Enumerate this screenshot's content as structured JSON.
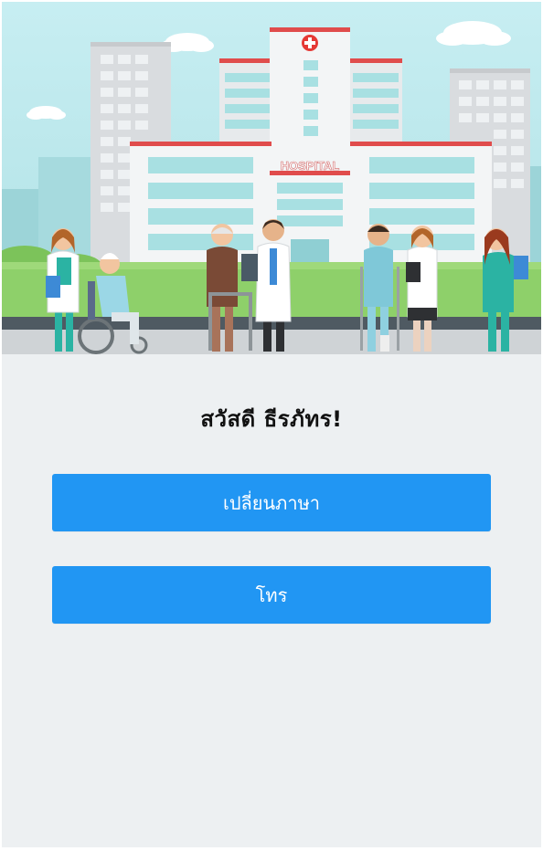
{
  "hero": {
    "sign_text": "HOSPITAL"
  },
  "greeting": {
    "text": "สวัสดี ธีรภัทร!"
  },
  "actions": [
    {
      "label": "เปลี่ยนภาษา"
    },
    {
      "label": "โทร"
    }
  ],
  "theme": {
    "background": "#edf0f2",
    "button_color": "#2196f3",
    "text_color": "#111111"
  }
}
